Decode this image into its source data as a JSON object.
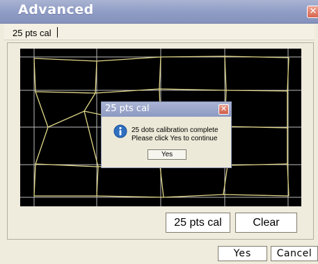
{
  "window": {
    "title": "Advanced",
    "close_glyph": "✕",
    "close_icon": "close-icon"
  },
  "field": {
    "value": "25 pts cal"
  },
  "buttons": {
    "pts_cal": "25 pts cal",
    "clear": "Clear",
    "yes": "Yes",
    "cancel": "Cancel"
  },
  "dialog": {
    "title": "25 pts cal",
    "close_glyph": "✕",
    "icon": "info-icon",
    "message_line1": "25 dots calibration complete",
    "message_line2": "Please click Yes to continue",
    "yes": "Yes"
  },
  "colors": {
    "titlebar": "#8e9bc4",
    "canvas_bg": "#000000",
    "grid_line": "#bdbdbd",
    "mesh_line": "#e3d98a",
    "close_button": "#d6654e",
    "info_icon": "#2f6fbf"
  }
}
